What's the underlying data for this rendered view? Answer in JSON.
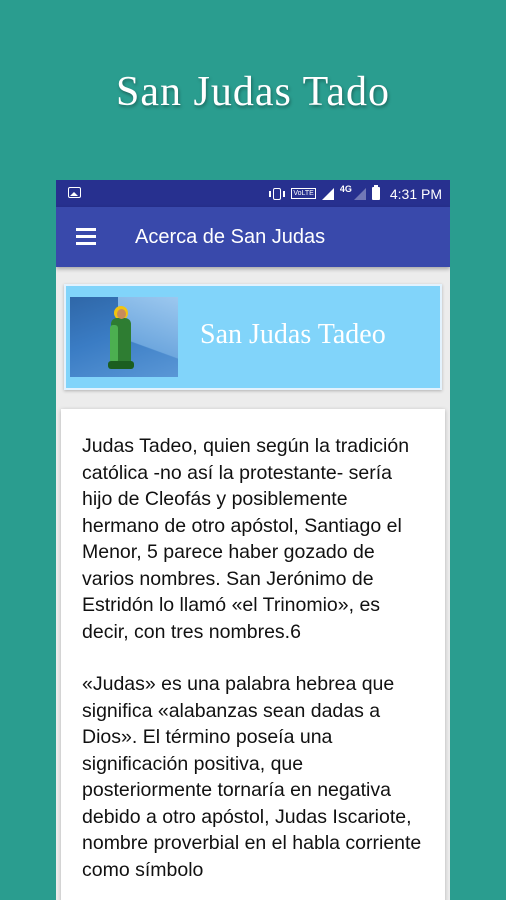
{
  "promo": {
    "title": "San Judas Tado"
  },
  "status_bar": {
    "volte_label": "VoLTE",
    "network_label": "4G",
    "time": "4:31 PM",
    "icons": [
      "image-icon",
      "vibrate-icon",
      "signal-icon",
      "battery-icon"
    ]
  },
  "app_bar": {
    "title": "Acerca de San Judas",
    "menu_icon": "hamburger-menu-icon",
    "color": "#3949ab"
  },
  "banner": {
    "title": "San Judas Tadeo",
    "color": "#81d4fa"
  },
  "article": {
    "paragraphs": [
      "Judas Tadeo, quien según la tradición católica -no así la protestante- sería hijo de Cleofás y posiblemente hermano de otro apóstol, Santiago el Menor, 5 parece haber gozado de varios nombres. San Jerónimo de Estridón lo llamó «el Trinomio», es decir, con tres nombres.6",
      "«Judas» es una palabra hebrea que significa «alabanzas sean dadas a Dios». El término poseía una significación positiva, que posteriormente tornaría en negativa debido a otro apóstol, Judas Iscariote, nombre proverbial en el habla corriente como símbolo"
    ]
  },
  "colors": {
    "background": "#2a9d8f",
    "status_bar": "#27308f"
  }
}
